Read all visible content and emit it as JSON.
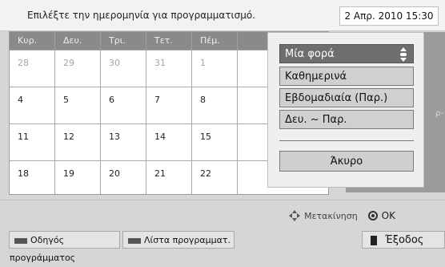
{
  "header": {
    "prompt": "Επιλέξτε την ημερομηνία για προγραμματισμό.",
    "datetime": "2 Απρ. 2010 15:30"
  },
  "calendar": {
    "weekdays": [
      "Κυρ.",
      "Δευ.",
      "Τρι.",
      "Τετ.",
      "Πέμ."
    ],
    "weeks": [
      [
        "28",
        "29",
        "30",
        "31",
        "1"
      ],
      [
        "4",
        "5",
        "6",
        "7",
        "8"
      ],
      [
        "11",
        "12",
        "13",
        "14",
        "15"
      ],
      [
        "18",
        "19",
        "20",
        "21",
        "22"
      ]
    ]
  },
  "side_text": "ρ-",
  "repeat_menu": {
    "options": [
      "Μία φορά",
      "Καθημερινά",
      "Εβδομαδιαία (Παρ.)",
      "Δευ. ~ Παρ."
    ],
    "selected": "Μία φορά",
    "cancel_label": "Άκυρο"
  },
  "footer": {
    "move_label": "Μετακίνηση",
    "ok_label": "OK",
    "guide_button": "Οδηγός προγράμματος",
    "list_button": "Λίστα προγραμματ.",
    "exit_button": "Έξοδος"
  },
  "icons": {
    "move": "four-arrows-icon",
    "ok": "ok-circle-icon",
    "guide": "red-key-icon",
    "list": "red-key-icon",
    "exit": "exit-key-icon"
  }
}
